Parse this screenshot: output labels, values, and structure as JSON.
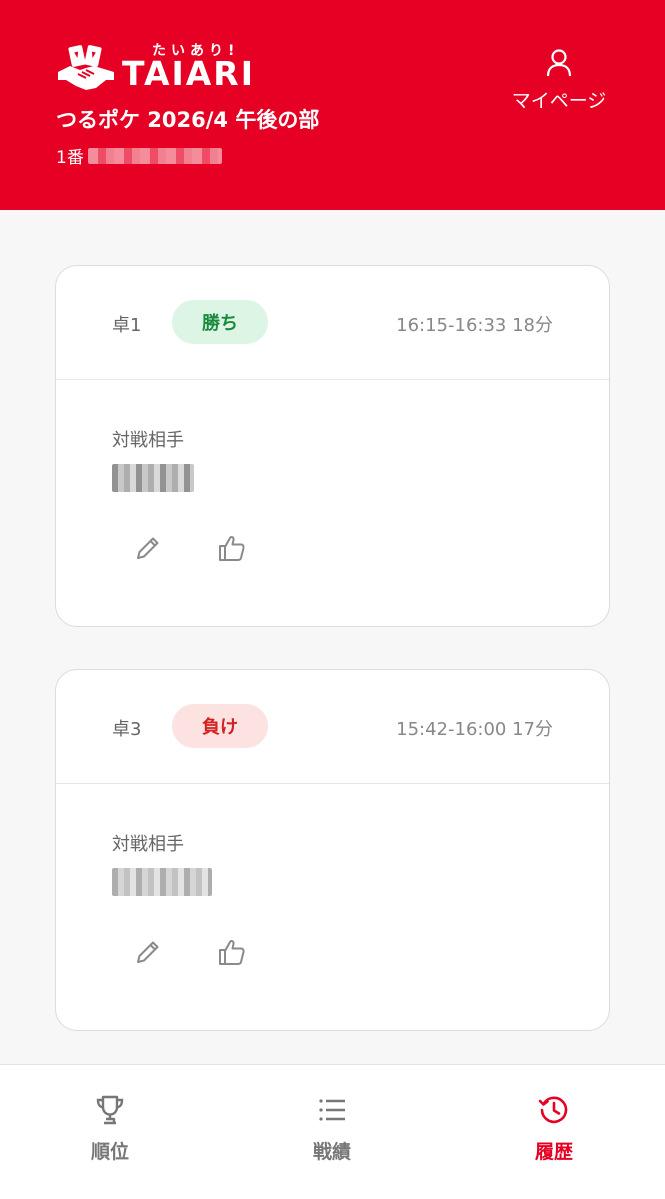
{
  "header": {
    "logo_kana": "たいあり!",
    "logo_text": "TAIARI",
    "mypage_label": "マイページ",
    "event_title": "つるポケ 2026/4 午後の部",
    "player_number": "1番"
  },
  "matches": [
    {
      "table": "卓1",
      "result": "勝ち",
      "result_type": "win",
      "time": "16:15-16:33 18分",
      "opponent_label": "対戦相手"
    },
    {
      "table": "卓3",
      "result": "負け",
      "result_type": "lose",
      "time": "15:42-16:00 17分",
      "opponent_label": "対戦相手"
    }
  ],
  "nav": {
    "items": [
      {
        "label": "順位",
        "icon": "trophy-icon"
      },
      {
        "label": "戦績",
        "icon": "list-icon"
      },
      {
        "label": "履歴",
        "icon": "history-icon"
      }
    ],
    "active": "履歴"
  },
  "colors": {
    "brand": "#e60023",
    "win_bg": "#ddf5e4",
    "win_text": "#1a8a3d",
    "lose_bg": "#fde2e2",
    "lose_text": "#d42020"
  }
}
